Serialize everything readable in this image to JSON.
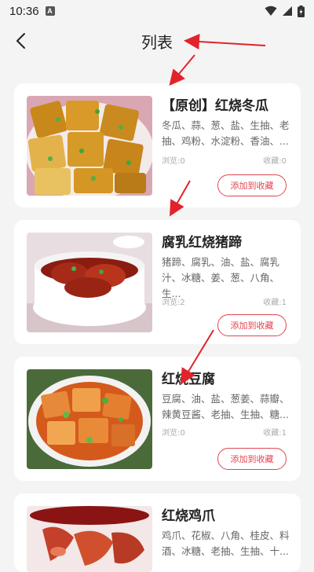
{
  "status_bar": {
    "time": "10:36",
    "a_icon": "A"
  },
  "header": {
    "title": "列表"
  },
  "colors": {
    "accent": "#e24552",
    "arrow": "#e2232b"
  },
  "recipes": [
    {
      "title": "【原创】红烧冬瓜",
      "ingredients": "冬瓜、蒜、葱、盐、生抽、老抽、鸡粉、水淀粉、香油、...",
      "views": "浏览:0",
      "favorites": "收藏:0",
      "button": "添加到收藏"
    },
    {
      "title": "腐乳红烧猪蹄",
      "ingredients": "猪蹄、腐乳、油、盐、腐乳汁、冰糖、姜、葱、八角、生...",
      "views": "浏览:2",
      "favorites": "收藏:1",
      "button": "添加到收藏"
    },
    {
      "title": "红烧豆腐",
      "ingredients": "豆腐、油、盐、葱姜、蒜瓣、辣黄豆酱、老抽、生抽、糖...",
      "views": "浏览:0",
      "favorites": "收藏:1",
      "button": "添加到收藏"
    },
    {
      "title": "红烧鸡爪",
      "ingredients": "鸡爪、花椒、八角、桂皮、料酒、冰糖、老抽、生抽、十...",
      "views": "",
      "favorites": "",
      "button": ""
    }
  ]
}
